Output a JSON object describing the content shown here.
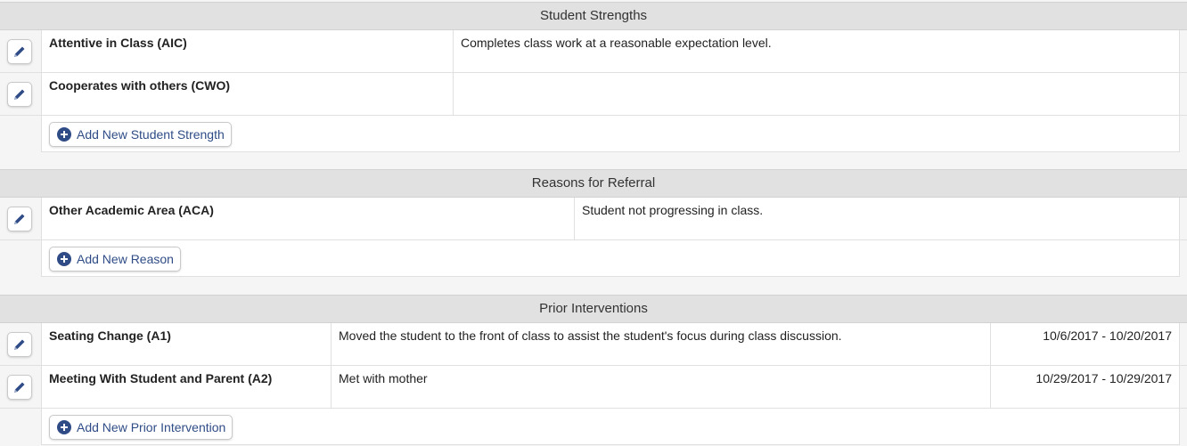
{
  "strengths": {
    "title": "Student Strengths",
    "rows": [
      {
        "name": "Attentive in Class (AIC)",
        "note": "Completes class work at a reasonable expectation level."
      },
      {
        "name": "Cooperates with others (CWO)",
        "note": ""
      }
    ],
    "add_label": "Add New Student Strength"
  },
  "referral": {
    "title": "Reasons for Referral",
    "rows": [
      {
        "name": "Other Academic Area (ACA)",
        "note": "Student not progressing in class."
      }
    ],
    "add_label": "Add New Reason"
  },
  "interventions": {
    "title": "Prior Interventions",
    "rows": [
      {
        "name": "Seating Change (A1)",
        "note": "Moved the student to the front of class to assist the student's focus during class discussion.",
        "dates": "10/6/2017 - 10/20/2017"
      },
      {
        "name": "Meeting With Student and Parent (A2)",
        "note": "Met with mother",
        "dates": "10/29/2017 - 10/29/2017"
      }
    ],
    "add_label": "Add New Prior Intervention"
  },
  "icons": {
    "edit": "pencil-icon",
    "add": "plus-circle-icon"
  },
  "colors": {
    "accent": "#2f4c86",
    "header_bg": "#e1e1e1"
  }
}
